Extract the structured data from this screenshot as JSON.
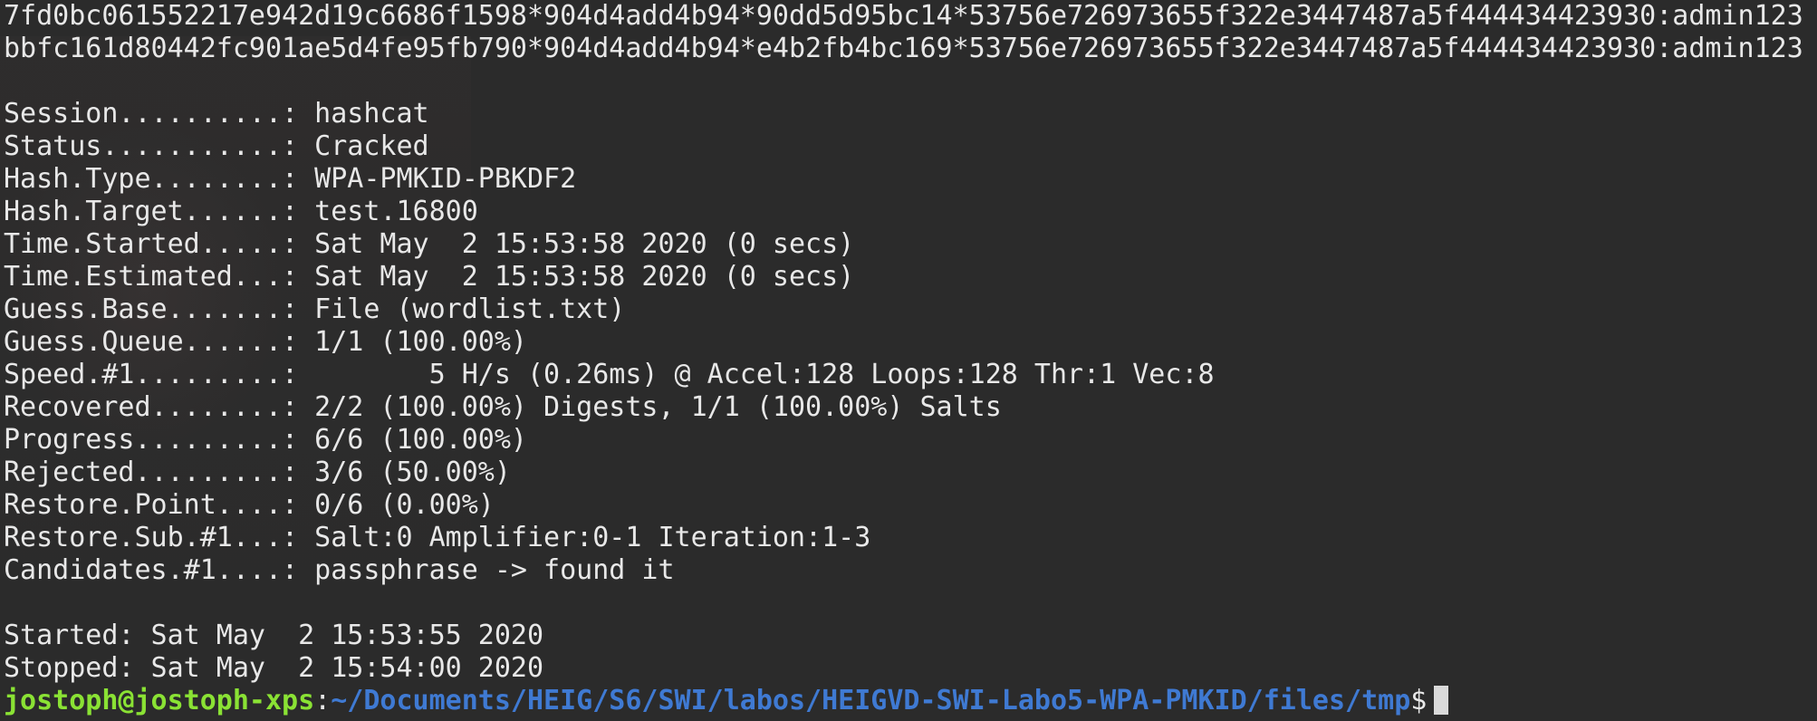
{
  "terminal": {
    "hash_lines": [
      "7fd0bc061552217e942d19c6686f1598*904d4add4b94*90dd5d95bc14*53756e726973655f322e3447487a5f444434423930:admin123",
      "bbfc161d80442fc901ae5d4fe95fb790*904d4add4b94*e4b2fb4bc169*53756e726973655f322e3447487a5f444434423930:admin123"
    ],
    "status": [
      "Session..........: hashcat",
      "Status...........: Cracked",
      "Hash.Type........: WPA-PMKID-PBKDF2",
      "Hash.Target......: test.16800",
      "Time.Started.....: Sat May  2 15:53:58 2020 (0 secs)",
      "Time.Estimated...: Sat May  2 15:53:58 2020 (0 secs)",
      "Guess.Base.......: File (wordlist.txt)",
      "Guess.Queue......: 1/1 (100.00%)",
      "Speed.#1.........:        5 H/s (0.26ms) @ Accel:128 Loops:128 Thr:1 Vec:8",
      "Recovered........: 2/2 (100.00%) Digests, 1/1 (100.00%) Salts",
      "Progress.........: 6/6 (100.00%)",
      "Rejected.........: 3/6 (50.00%)",
      "Restore.Point....: 0/6 (0.00%)",
      "Restore.Sub.#1...: Salt:0 Amplifier:0-1 Iteration:1-3",
      "Candidates.#1....: passphrase -> found it"
    ],
    "timing": [
      "Started: Sat May  2 15:53:55 2020",
      "Stopped: Sat May  2 15:54:00 2020"
    ],
    "prompt": {
      "user_host": "jostoph@jostoph-xps",
      "separator": ":",
      "path": "~/Documents/HEIG/S6/SWI/labos/HEIGVD-SWI-Labo5-WPA-PMKID/files/tmp",
      "symbol": "$"
    }
  }
}
